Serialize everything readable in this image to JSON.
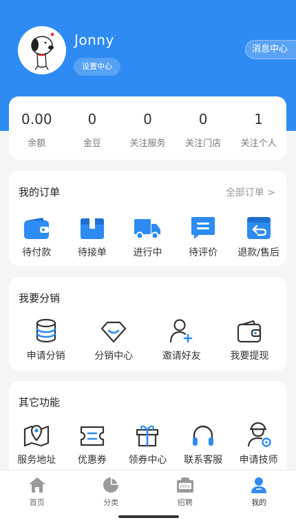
{
  "profile": {
    "username": "Jonny",
    "settings_label": "设置中心",
    "messages_label": "消息中心"
  },
  "stats": [
    {
      "value": "0.00",
      "label": "余额"
    },
    {
      "value": "0",
      "label": "金豆"
    },
    {
      "value": "0",
      "label": "关注服务"
    },
    {
      "value": "0",
      "label": "关注门店"
    },
    {
      "value": "1",
      "label": "关注个人"
    }
  ],
  "orders": {
    "title": "我的订单",
    "all_label": "全部订单 >",
    "items": [
      {
        "label": "待付款",
        "icon": "wallet-icon"
      },
      {
        "label": "待接单",
        "icon": "package-icon"
      },
      {
        "label": "进行中",
        "icon": "truck-icon"
      },
      {
        "label": "待评价",
        "icon": "comment-icon"
      },
      {
        "label": "退款/售后",
        "icon": "return-box-icon"
      }
    ]
  },
  "distribution": {
    "title": "我要分销",
    "items": [
      {
        "label": "申请分销",
        "icon": "coins-stack-icon"
      },
      {
        "label": "分销中心",
        "icon": "diamond-icon"
      },
      {
        "label": "邀请好友",
        "icon": "add-user-icon"
      },
      {
        "label": "我要提现",
        "icon": "withdraw-wallet-icon"
      }
    ]
  },
  "other": {
    "title": "其它功能",
    "items": [
      {
        "label": "服务地址",
        "icon": "map-pin-icon"
      },
      {
        "label": "优惠券",
        "icon": "ticket-icon"
      },
      {
        "label": "领券中心",
        "icon": "gift-icon"
      },
      {
        "label": "联系客服",
        "icon": "headphones-icon"
      },
      {
        "label": "申请技师",
        "icon": "technician-icon"
      }
    ]
  },
  "tabbar": [
    {
      "label": "首页",
      "icon": "home-icon"
    },
    {
      "label": "分类",
      "icon": "pie-chart-icon"
    },
    {
      "label": "招聘",
      "icon": "hire-icon",
      "badge": "Hire"
    },
    {
      "label": "我的",
      "icon": "user-icon",
      "active": true
    }
  ],
  "colors": {
    "primary": "#2d8bf3",
    "icon_dark": "#333333",
    "tab_inactive": "#9a9a9a"
  }
}
